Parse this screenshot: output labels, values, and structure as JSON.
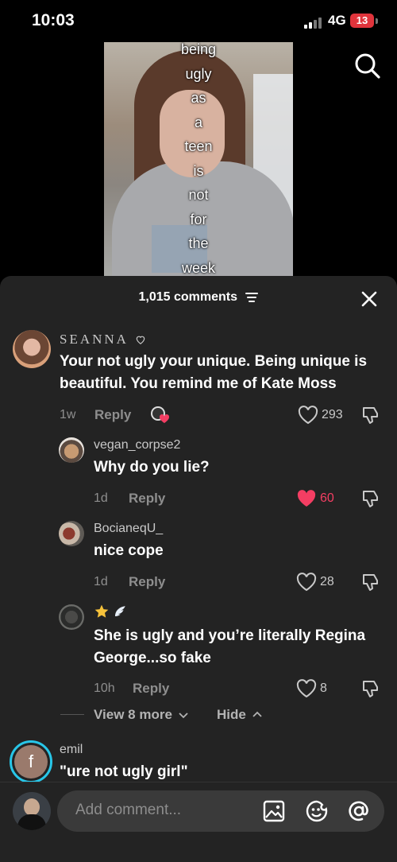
{
  "status_bar": {
    "time": "10:03",
    "network": "4G",
    "battery": "13"
  },
  "video": {
    "overlay_words": [
      "being",
      "ugly",
      "as",
      "a",
      "teen",
      "is",
      "not",
      "for",
      "the",
      "week"
    ]
  },
  "header": {
    "comments_count": "1,015 comments"
  },
  "comments": [
    {
      "username": "SEANNA",
      "text": "Your not ugly your unique. Being unique is beautiful. You remind me of Kate Moss",
      "time": "1w",
      "reply": "Reply",
      "likes": "293"
    },
    {
      "username": "vegan_corpse2",
      "text": "Why do you lie?",
      "time": "1d",
      "reply": "Reply",
      "likes": "60",
      "liked": true
    },
    {
      "username": "BocianeqU_",
      "text": "nice cope",
      "time": "1d",
      "reply": "Reply",
      "likes": "28"
    },
    {
      "username": "",
      "text": "She is ugly and you’re literally Regina George...so fake",
      "time": "10h",
      "reply": "Reply",
      "likes": "8"
    },
    {
      "username": "emil",
      "text": "\"ure not ugly girl\"",
      "avatar_letter": "f"
    }
  ],
  "thread_controls": {
    "view_more": "View 8 more",
    "hide": "Hide"
  },
  "composer": {
    "placeholder": "Add comment..."
  },
  "colors": {
    "like_red": "#f43e63",
    "sheet_bg": "#232323",
    "story_ring": "#28c6e8"
  }
}
